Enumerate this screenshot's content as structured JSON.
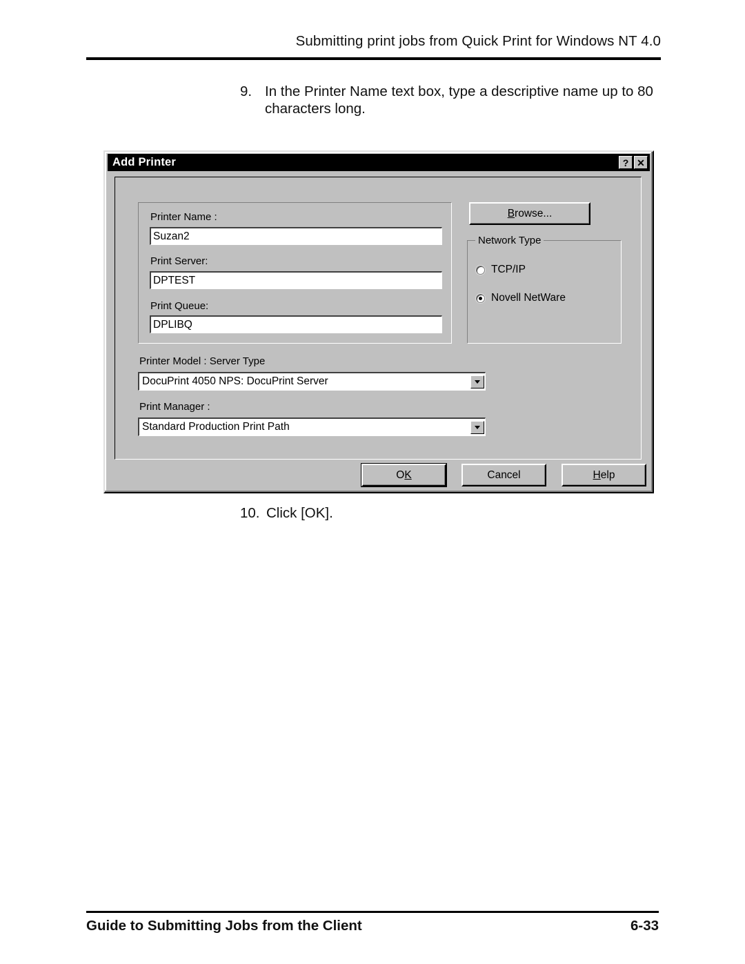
{
  "page": {
    "header_title": "Submitting print jobs from Quick Print for Windows NT 4.0",
    "footer_left": "Guide to Submitting Jobs from the Client",
    "footer_page": "6-33"
  },
  "steps": [
    {
      "number": "9.",
      "text": "In the Printer Name text box, type a descriptive name up to 80 characters long."
    },
    {
      "number": "10.",
      "text": "Click [OK]."
    }
  ],
  "dialog": {
    "title": "Add Printer",
    "title_buttons": [
      {
        "icon": "help-question-icon",
        "glyph": "?"
      },
      {
        "icon": "close-x-icon",
        "glyph": "✕"
      }
    ],
    "fields": [
      {
        "label": "Printer Name :",
        "value": "Suzan2"
      },
      {
        "label": "Print Server:",
        "value": "DPTEST"
      },
      {
        "label": "Print Queue:",
        "value": "DPLIBQ"
      }
    ],
    "browse_button": {
      "prefix": "",
      "accel": "B",
      "suffix": "rowse..."
    },
    "network_type": {
      "title": "Network Type",
      "options": [
        {
          "label": "TCP/IP",
          "selected": false
        },
        {
          "label": "Novell NetWare",
          "selected": true
        }
      ]
    },
    "combos": [
      {
        "label": "Printer Model : Server Type",
        "value": "DocuPrint 4050 NPS: DocuPrint Server"
      },
      {
        "label": "Print Manager :",
        "value": "Standard Production Print Path"
      }
    ],
    "buttons": [
      {
        "prefix": "O",
        "accel": "K",
        "suffix": "",
        "default": true
      },
      {
        "prefix": "Cancel",
        "accel": "",
        "suffix": "",
        "default": false
      },
      {
        "prefix": "",
        "accel": "H",
        "suffix": "elp",
        "default": false
      }
    ]
  },
  "colors": {
    "dialog_face": "#c0c0c0",
    "titlebar": "#000000",
    "titlebar_text": "#ffffff",
    "field_bg": "#ffffff",
    "page_bg": "#ffffff",
    "ink": "#000000"
  }
}
